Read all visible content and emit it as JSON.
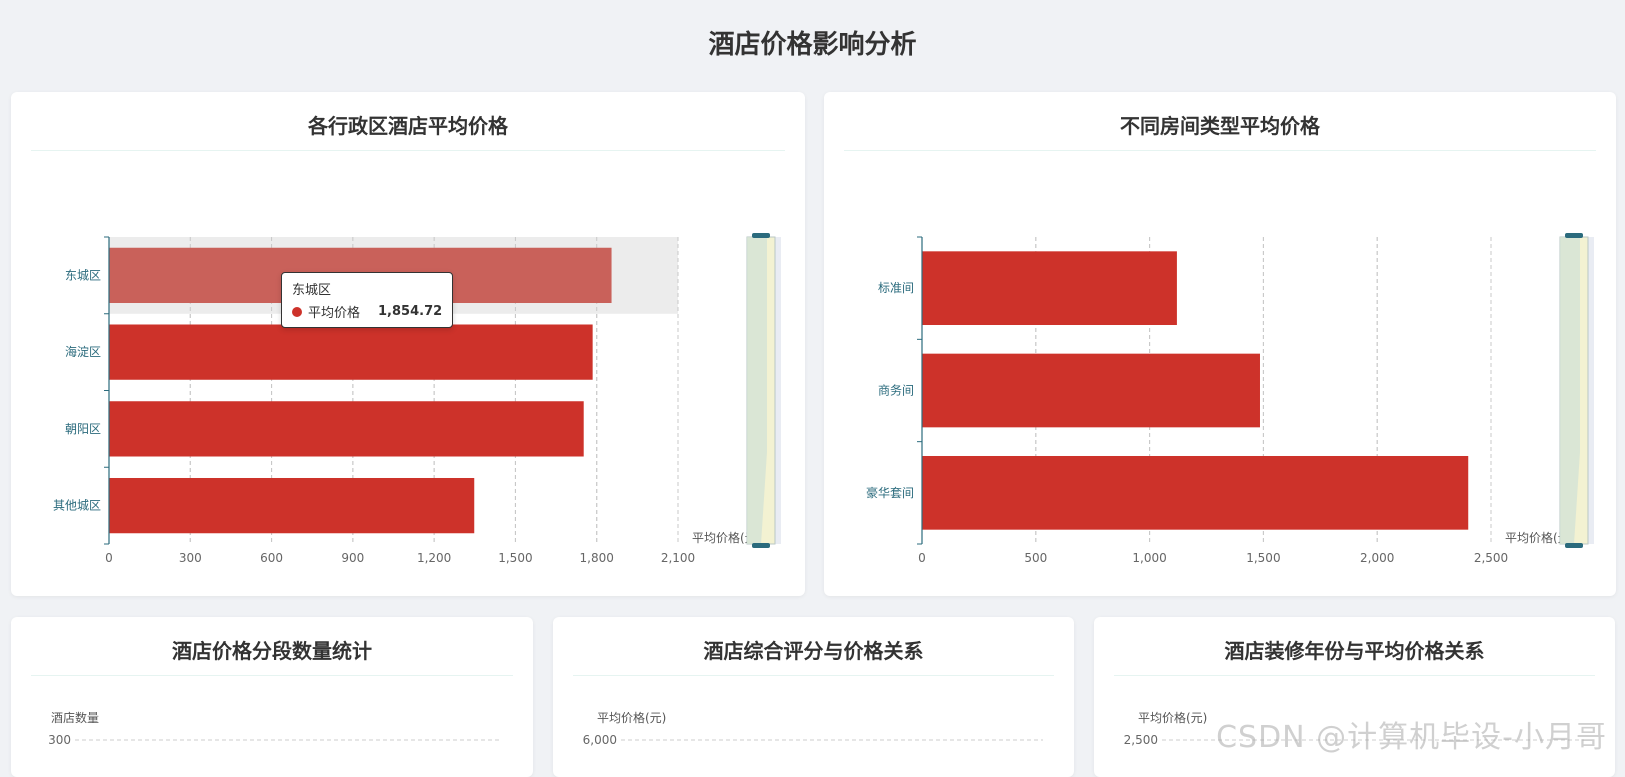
{
  "page": {
    "title": "酒店价格影响分析"
  },
  "colors": {
    "bar": "#cd322a",
    "bar_highlight": "#c9615a",
    "axis": "#2b6b7d",
    "slider": "#2b6b7d"
  },
  "cards": {
    "district": {
      "title": "各行政区酒店平均价格",
      "tooltip": {
        "category": "东城区",
        "series": "平均价格",
        "value": "1,854.72"
      }
    },
    "room": {
      "title": "不同房间类型平均价格"
    },
    "segment": {
      "title": "酒店价格分段数量统计"
    },
    "rating": {
      "title": "酒店综合评分与价格关系"
    },
    "renovation": {
      "title": "酒店装修年份与平均价格关系"
    }
  },
  "watermark": "CSDN @计算机毕设-小月哥",
  "chart_data": [
    {
      "id": "district",
      "type": "bar",
      "orientation": "horizontal",
      "categories": [
        "东城区",
        "海淀区",
        "朝阳区",
        "其他城区"
      ],
      "values": [
        1854.72,
        1785,
        1752,
        1348
      ],
      "xlabel": "平均价格(元)",
      "xlim": [
        0,
        2100
      ],
      "xticks": [
        0,
        300,
        600,
        900,
        1200,
        1500,
        1800,
        2100
      ],
      "xtick_labels": [
        "0",
        "300",
        "600",
        "900",
        "1,200",
        "1,500",
        "1,800",
        "2,100"
      ],
      "highlight": "东城区",
      "grid": true
    },
    {
      "id": "room",
      "type": "bar",
      "orientation": "horizontal",
      "categories": [
        "标准间",
        "商务间",
        "豪华套间"
      ],
      "values": [
        1120,
        1485,
        2400
      ],
      "xlabel": "平均价格(元)",
      "xlim": [
        0,
        2500
      ],
      "xticks": [
        0,
        500,
        1000,
        1500,
        2000,
        2500
      ],
      "xtick_labels": [
        "0",
        "500",
        "1,000",
        "1,500",
        "2,000",
        "2,500"
      ],
      "grid": true
    },
    {
      "id": "segment",
      "type": "bar",
      "ylabel": "酒店数量",
      "top_tick": "300"
    },
    {
      "id": "rating",
      "type": "scatter",
      "ylabel": "平均价格(元)",
      "top_tick": "6,000"
    },
    {
      "id": "renovation",
      "type": "line",
      "ylabel": "平均价格(元)",
      "top_tick": "2,500"
    }
  ]
}
